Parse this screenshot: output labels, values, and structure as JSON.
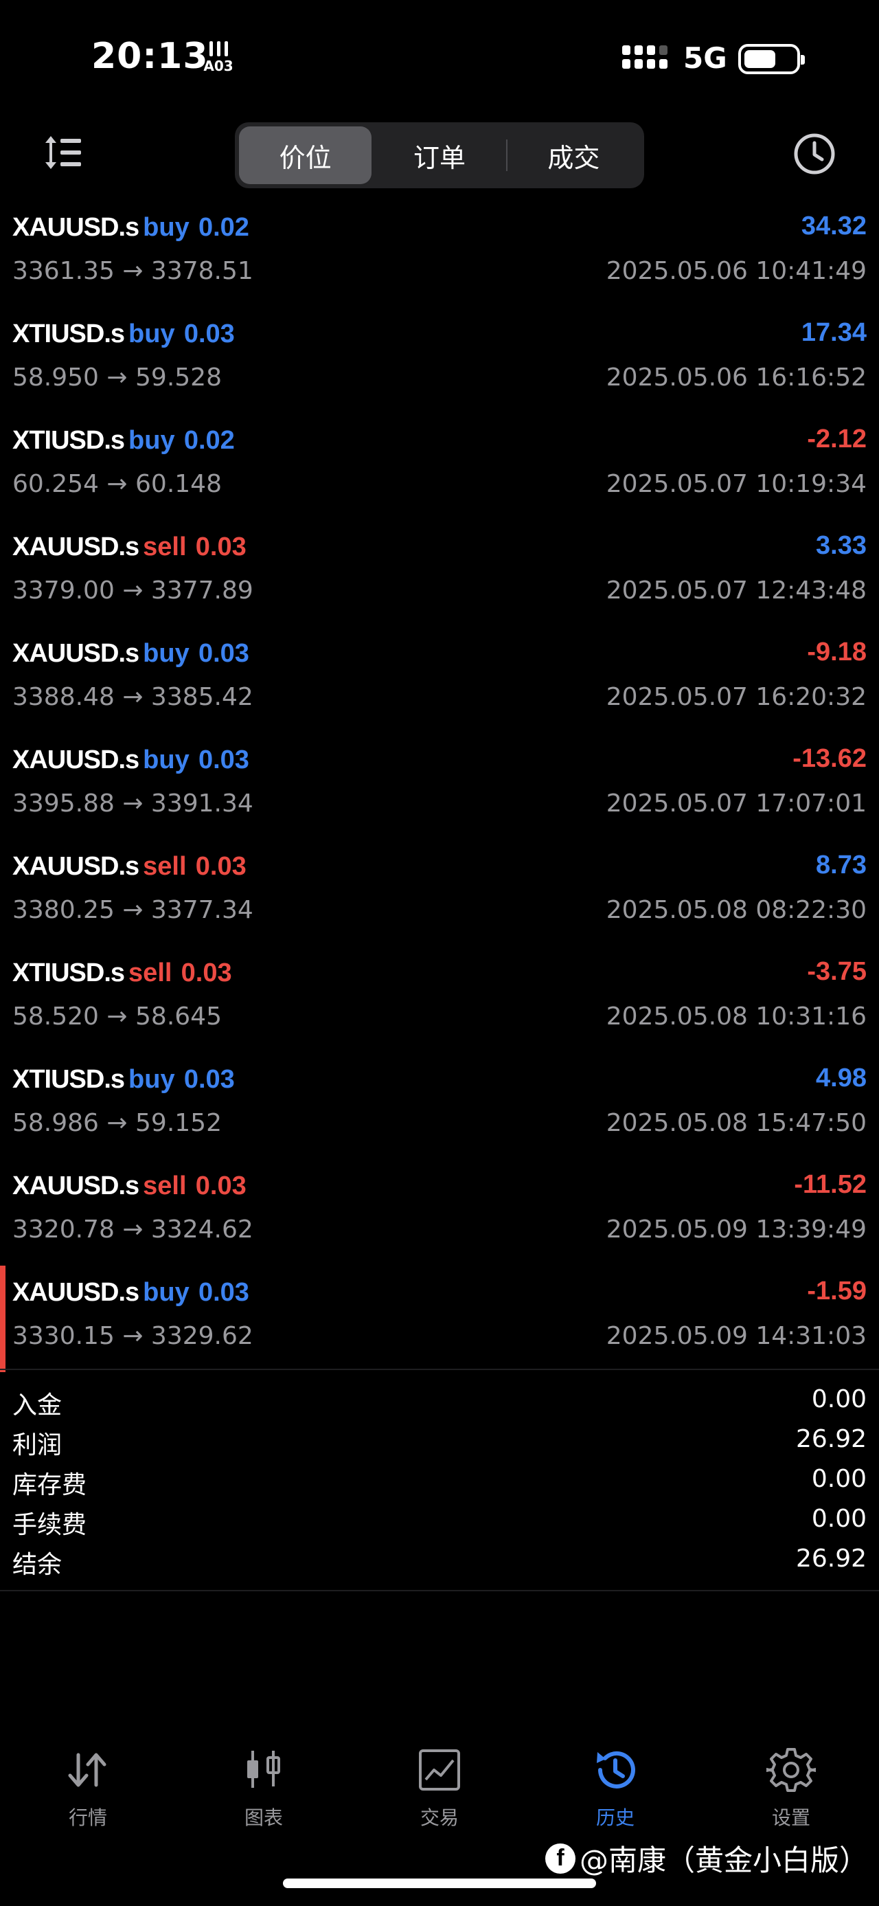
{
  "status_bar": {
    "time": "20:13",
    "badge": "A03",
    "network": "5G"
  },
  "header": {
    "segments": [
      {
        "label": "价位",
        "active": true
      },
      {
        "label": "订单",
        "active": false
      },
      {
        "label": "成交",
        "active": false
      }
    ]
  },
  "deals": [
    {
      "symbol": "XAUUSD.s",
      "type": "buy",
      "volume": "0.02",
      "profit": "34.32",
      "prices": "3361.35 → 3378.51",
      "time": "2025.05.06 10:41:49"
    },
    {
      "symbol": "XTIUSD.s",
      "type": "buy",
      "volume": "0.03",
      "profit": "17.34",
      "prices": "58.950 → 59.528",
      "time": "2025.05.06 16:16:52"
    },
    {
      "symbol": "XTIUSD.s",
      "type": "buy",
      "volume": "0.02",
      "profit": "-2.12",
      "prices": "60.254 → 60.148",
      "time": "2025.05.07 10:19:34"
    },
    {
      "symbol": "XAUUSD.s",
      "type": "sell",
      "volume": "0.03",
      "profit": "3.33",
      "prices": "3379.00 → 3377.89",
      "time": "2025.05.07 12:43:48"
    },
    {
      "symbol": "XAUUSD.s",
      "type": "buy",
      "volume": "0.03",
      "profit": "-9.18",
      "prices": "3388.48 → 3385.42",
      "time": "2025.05.07 16:20:32"
    },
    {
      "symbol": "XAUUSD.s",
      "type": "buy",
      "volume": "0.03",
      "profit": "-13.62",
      "prices": "3395.88 → 3391.34",
      "time": "2025.05.07 17:07:01"
    },
    {
      "symbol": "XAUUSD.s",
      "type": "sell",
      "volume": "0.03",
      "profit": "8.73",
      "prices": "3380.25 → 3377.34",
      "time": "2025.05.08 08:22:30"
    },
    {
      "symbol": "XTIUSD.s",
      "type": "sell",
      "volume": "0.03",
      "profit": "-3.75",
      "prices": "58.520 → 58.645",
      "time": "2025.05.08 10:31:16"
    },
    {
      "symbol": "XTIUSD.s",
      "type": "buy",
      "volume": "0.03",
      "profit": "4.98",
      "prices": "58.986 → 59.152",
      "time": "2025.05.08 15:47:50"
    },
    {
      "symbol": "XAUUSD.s",
      "type": "sell",
      "volume": "0.03",
      "profit": "-11.52",
      "prices": "3320.78 → 3324.62",
      "time": "2025.05.09 13:39:49"
    },
    {
      "symbol": "XAUUSD.s",
      "type": "buy",
      "volume": "0.03",
      "profit": "-1.59",
      "prices": "3330.15 → 3329.62",
      "time": "2025.05.09 14:31:03",
      "selected": true
    }
  ],
  "summary": [
    {
      "label": "入金",
      "value": "0.00"
    },
    {
      "label": "利润",
      "value": "26.92"
    },
    {
      "label": "库存费",
      "value": "0.00"
    },
    {
      "label": "手续费",
      "value": "0.00"
    },
    {
      "label": "结余",
      "value": "26.92"
    }
  ],
  "tabs": [
    {
      "label": "行情",
      "icon": "quotes-icon",
      "active": false
    },
    {
      "label": "图表",
      "icon": "chart-icon",
      "active": false
    },
    {
      "label": "交易",
      "icon": "trade-icon",
      "active": false
    },
    {
      "label": "历史",
      "icon": "history-icon",
      "active": true
    },
    {
      "label": "设置",
      "icon": "settings-icon",
      "active": false
    }
  ],
  "watermark": {
    "logo": "f",
    "text": "@南康（黄金小白版）"
  },
  "colors": {
    "buy": "#3c82f0",
    "sell": "#ec4b43",
    "muted": "#9a9a9e",
    "background": "#000000",
    "selected_bar": "#e8453c"
  }
}
